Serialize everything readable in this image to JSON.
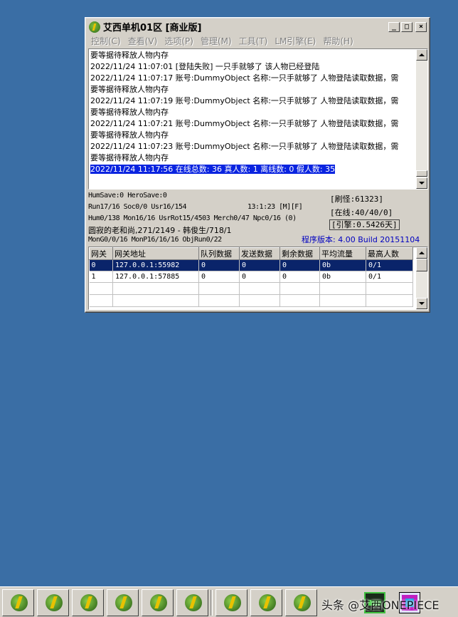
{
  "window": {
    "title": "艾西单机01区 [商业版]",
    "buttons": {
      "minimize": "_",
      "maximize": "□",
      "close": "×"
    }
  },
  "menu": [
    {
      "label": "控制(C)"
    },
    {
      "label": "查看(V)"
    },
    {
      "label": "选项(P)"
    },
    {
      "label": "管理(M)"
    },
    {
      "label": "工具(T)"
    },
    {
      "label": "LM引擎(E)"
    },
    {
      "label": "帮助(H)"
    }
  ],
  "log": [
    "要等据待释放人物内存",
    "2022/11/24 11:07:01 [登陆失败] 一只手就够了 该人物已经登陆",
    "2022/11/24 11:07:17 账号:DummyObject 名称:一只手就够了 人物登陆读取数据，需",
    "要等据待释放人物内存",
    "2022/11/24 11:07:19 账号:DummyObject 名称:一只手就够了 人物登陆读取数据，需",
    "要等据待释放人物内存",
    "2022/11/24 11:07:21 账号:DummyObject 名称:一只手就够了 人物登陆读取数据，需",
    "要等据待释放人物内存",
    "2022/11/24 11:07:23 账号:DummyObject 名称:一只手就够了 人物登陆读取数据，需",
    "要等据待释放人物内存"
  ],
  "log_selected": "2022/11/24 11:17:56 在线总数: 36 真人数: 1 离线数: 0 假人数: 35",
  "status": {
    "line1": "HumSave:0 HeroSave:0",
    "line2": "Run17/16 Soc0/0 Usr16/154",
    "time": "13:1:23 [M][F]",
    "line3": "Hum0/138 Mon16/16 UsrRot15/4503 Merch0/47 Npc0/16 (0)",
    "line4": "圆寂的老和尚,271/2149 - 韩俊生/718/1",
    "line5": "MonG0/0/16 MonP16/16/16 ObjRun0/22",
    "refresh": "[刷怪:61323]",
    "online": "[在线:40/40/0]",
    "engine": "[引擎:0.5426天]",
    "version": "程序版本: 4.00 Build 20151104"
  },
  "grid": {
    "headers": [
      "网关",
      "网关地址",
      "队列数据",
      "发送数据",
      "剩余数据",
      "平均流量",
      "最高人数"
    ],
    "rows": [
      [
        "0",
        "127.0.0.1:55982",
        "0",
        "0",
        "0",
        "0b",
        "0/1"
      ],
      [
        "1",
        "127.0.0.1:57885",
        "0",
        "0",
        "0",
        "0b",
        "0/1"
      ]
    ]
  },
  "taskbar": {
    "watermark": "头条 @艾西ONEPIECE"
  }
}
